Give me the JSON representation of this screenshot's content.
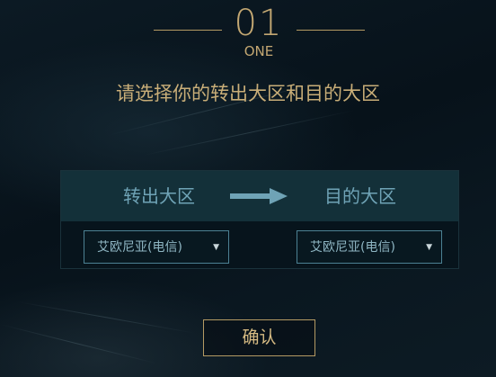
{
  "step": {
    "number": "01",
    "word": "ONE"
  },
  "instruction": "请选择你的转出大区和目的大区",
  "transfer": {
    "from_label": "转出大区",
    "to_label": "目的大区",
    "arrow_icon": "right-arrow-icon",
    "from_select": {
      "value": "艾欧尼亚(电信)",
      "caret": "▼"
    },
    "to_select": {
      "value": "艾欧尼亚(电信)",
      "caret": "▼"
    }
  },
  "confirm_label": "确认",
  "colors": {
    "gold": "#c3a772",
    "label_blue": "#6fa3b6",
    "panel_head": "#133039",
    "background": "#07121a"
  }
}
